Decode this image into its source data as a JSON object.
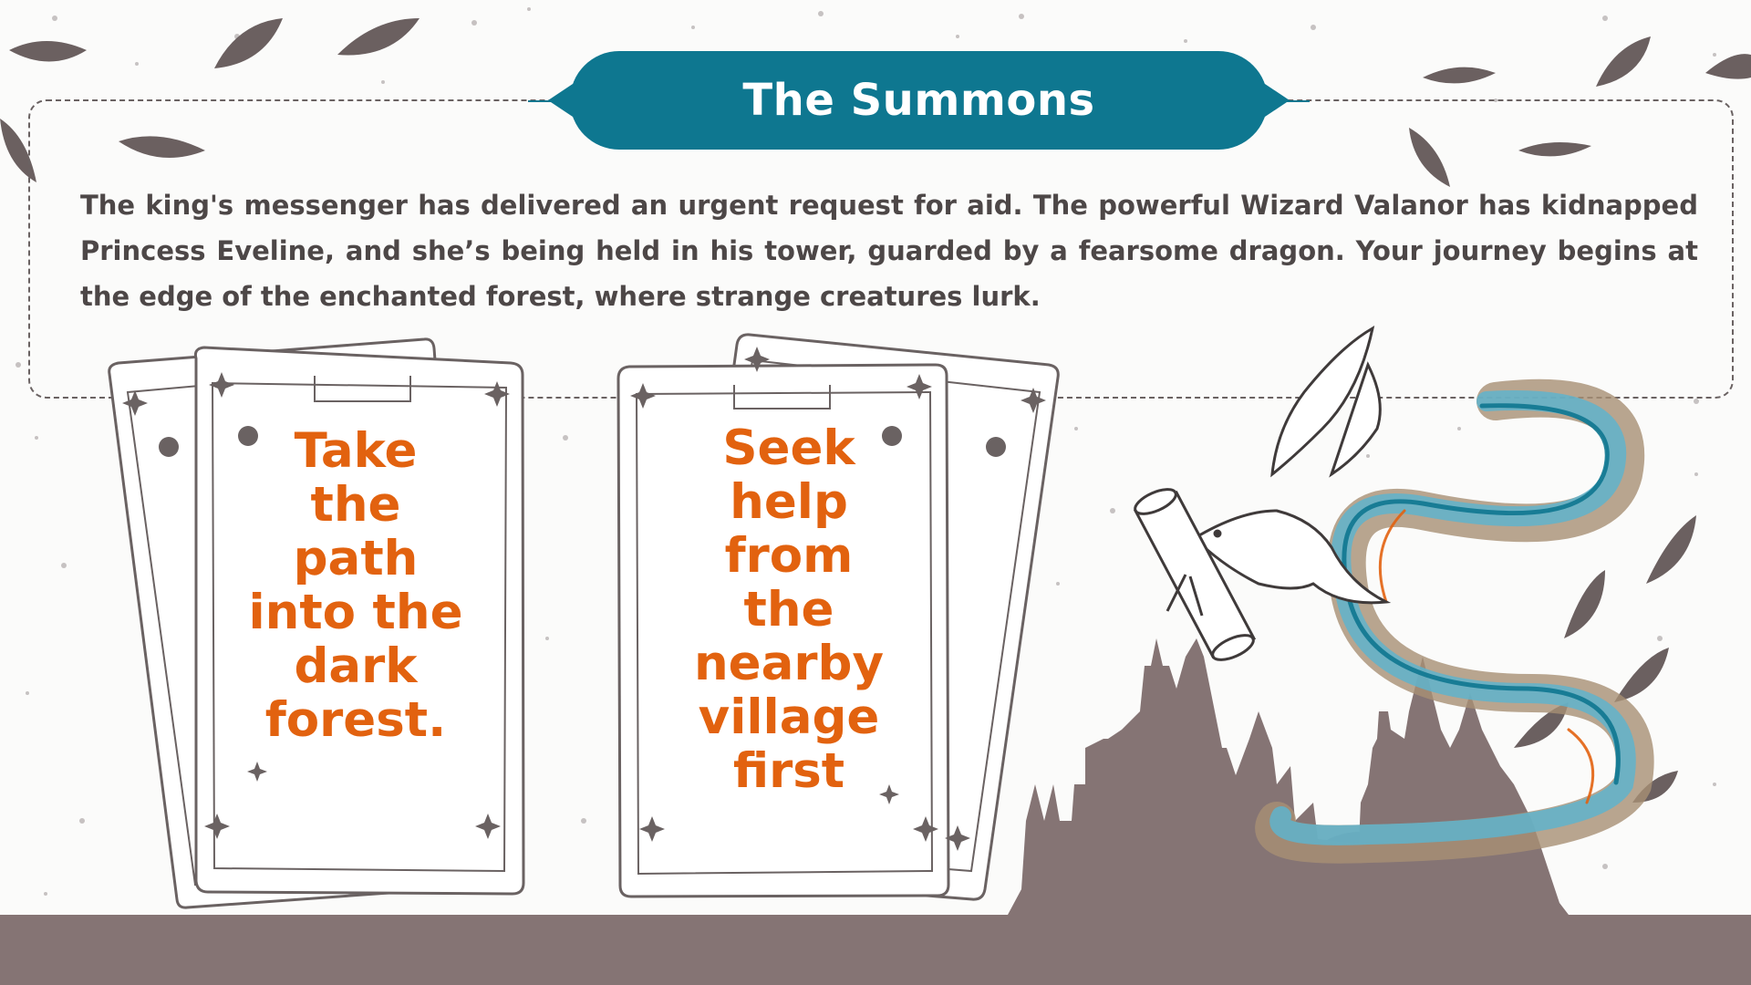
{
  "slide": {
    "title": "The Summons",
    "story": "The king's messenger has delivered an urgent request for aid. The powerful Wizard Valanor has kidnapped Princess Eveline, and she’s being held in his tower, guarded by a fearsome dragon. Your journey begins at the edge of the enchanted forest, where strange creatures lurk."
  },
  "choices": [
    {
      "label": "Take the path into the dark forest."
    },
    {
      "label": "Seek help from the nearby village first"
    }
  ],
  "colors": {
    "title_banner": "#0e7790",
    "choice_text": "#e2620f",
    "story_text": "#4d4747",
    "silhouette": "#857474",
    "leaf": "#6b6060",
    "magic_blue": "#5fb3cc",
    "magic_tan": "#a89074"
  },
  "icons": [
    "leaf-icon",
    "sparkle-icon",
    "planet-icon",
    "dove-icon",
    "scroll-icon",
    "castle-icon"
  ]
}
